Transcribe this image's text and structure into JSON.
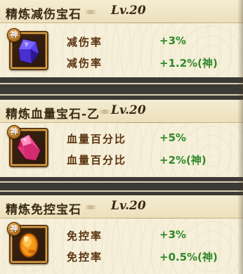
{
  "items": [
    {
      "name": "精炼减伤宝石",
      "level": "Lv.20",
      "badge": "神",
      "gem_icon": "purple-crystal-gem-icon",
      "gem_color": "#5a3ff0",
      "stats": [
        {
          "name": "减伤率",
          "value": "+3%"
        },
        {
          "name": "减伤率",
          "value": "+1.2%(神)"
        }
      ]
    },
    {
      "name": "精炼血量宝石-乙",
      "level": "Lv.20",
      "badge": "神",
      "gem_icon": "pink-crystal-gem-icon",
      "gem_color": "#f04a8c",
      "stats": [
        {
          "name": "血量百分比",
          "value": "+5%"
        },
        {
          "name": "血量百分比",
          "value": "+2%(神)"
        }
      ]
    },
    {
      "name": "精炼免控宝石",
      "level": "Lv.20",
      "badge": "神",
      "gem_icon": "orange-oval-gem-icon",
      "gem_color": "#f39a1a",
      "stats": [
        {
          "name": "免控率",
          "value": "+3%"
        },
        {
          "name": "免控率",
          "value": "+0.5%(神)"
        }
      ]
    }
  ],
  "colors": {
    "stat_label": "#5a3410",
    "stat_value": "#2f8a2a",
    "title": "#3a2a14",
    "card_bg": "#f6efd9"
  }
}
